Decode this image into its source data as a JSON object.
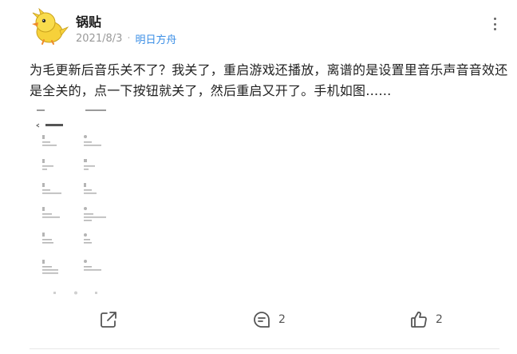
{
  "post": {
    "author": "锅贴",
    "date": "2021/8/3",
    "game": "明日方舟",
    "content": "为毛更新后音乐关不了？我关了，重启游戏还播放，离谱的是设置里音乐声音音效还是全关的，点一下按钮就关了，然后重启又开了。手机如图……"
  },
  "actions": {
    "share_icon": "share-icon",
    "comment_icon": "comment-icon",
    "comment_count": "2",
    "like_icon": "thumbs-up-icon",
    "like_count": "2"
  },
  "colors": {
    "accent": "#3a8ee6",
    "meta": "#999999",
    "icon": "#555555"
  }
}
